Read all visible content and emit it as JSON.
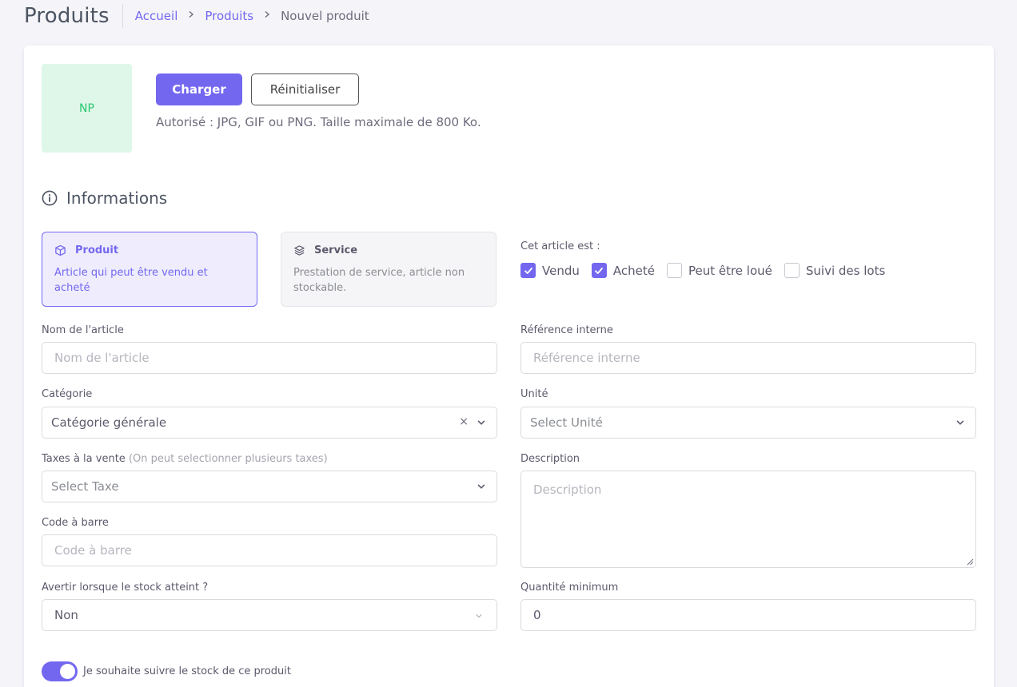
{
  "header": {
    "title": "Produits",
    "breadcrumb": {
      "home": "Accueil",
      "section": "Produits",
      "current": "Nouvel produit"
    }
  },
  "avatar": {
    "initials": "NP",
    "bg_color": "#dff7e9",
    "text_color": "#28c76f"
  },
  "upload": {
    "upload_label": "Charger",
    "reset_label": "Réinitialiser",
    "hint": "Autorisé : JPG, GIF ou PNG. Taille maximale de 800 Ko."
  },
  "section": {
    "title": "Informations",
    "icon": "info-circle-icon"
  },
  "types": {
    "product": {
      "title": "Produit",
      "desc": "Article qui peut être vendu et acheté",
      "icon": "cube-icon",
      "selected": true
    },
    "service": {
      "title": "Service",
      "desc": "Prestation de service, article non stockable.",
      "icon": "layers-icon",
      "selected": false
    }
  },
  "article_is": {
    "label": "Cet article est :",
    "options": [
      {
        "label": "Vendu",
        "checked": true
      },
      {
        "label": "Acheté",
        "checked": true
      },
      {
        "label": "Peut être loué",
        "checked": false
      },
      {
        "label": "Suivi des lots",
        "checked": false
      }
    ]
  },
  "form": {
    "name": {
      "label": "Nom de l'article",
      "placeholder": "Nom de l'article"
    },
    "ref": {
      "label": "Référence interne",
      "placeholder": "Référence interne"
    },
    "category": {
      "label": "Catégorie",
      "value": "Catégorie générale"
    },
    "unit": {
      "label": "Unité",
      "placeholder": "Select Unité"
    },
    "taxes": {
      "label": "Taxes à la vente",
      "hint": "(On peut selectionner plusieurs taxes)",
      "placeholder": "Select Taxe"
    },
    "description": {
      "label": "Description",
      "placeholder": "Description"
    },
    "barcode": {
      "label": "Code à barre",
      "placeholder": "Code à barre"
    },
    "stock_alert": {
      "label": "Avertir lorsque le stock atteint ?",
      "value": "Non"
    },
    "min_qty": {
      "label": "Quantité minimum",
      "value": "0"
    },
    "track_stock": {
      "label": "Je souhaite suivre le stock de ce produit",
      "on": true
    }
  },
  "colors": {
    "primary": "#7367f0",
    "primary_light": "#efedfd",
    "background": "#f5f5f9"
  }
}
